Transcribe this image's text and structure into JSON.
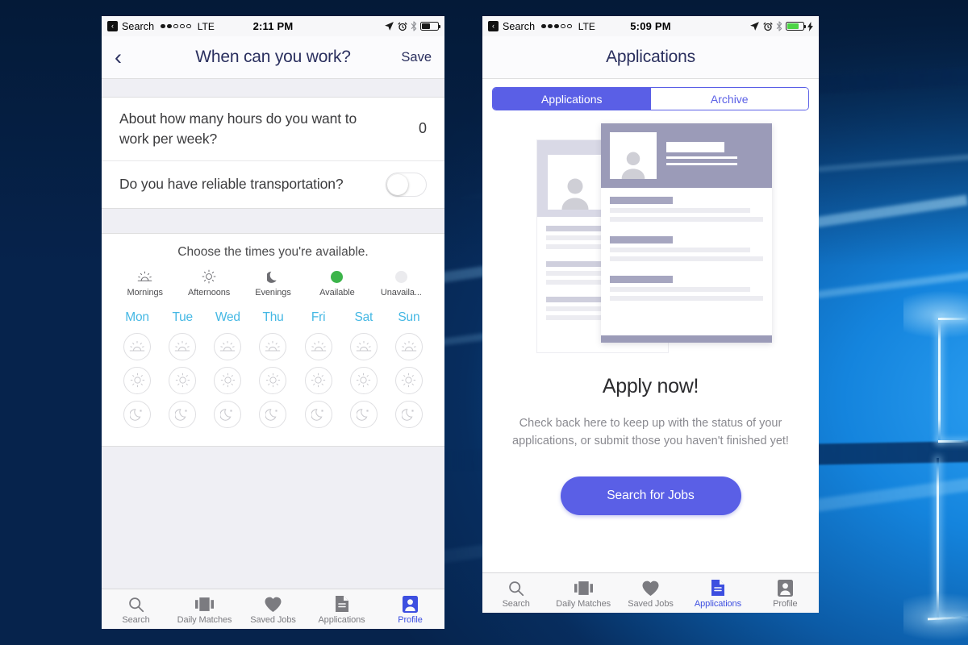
{
  "desktop": {
    "wallpaper_name": "windows-10-hero-wallpaper"
  },
  "left_phone": {
    "statusbar": {
      "back_badge": "‹",
      "carrier_label": "Search",
      "signal_dots_filled": 2,
      "signal_dots_total": 5,
      "network": "LTE",
      "time": "2:11 PM",
      "battery_level_pct": 55,
      "battery_charging": false
    },
    "navbar": {
      "back_icon": "‹",
      "title": "When can you work?",
      "action_label": "Save"
    },
    "form": {
      "hours_question": "About how many hours do you want to work per week?",
      "hours_value": "0",
      "transportation_question": "Do you have reliable transportation?",
      "transportation_on": false
    },
    "availability": {
      "title": "Choose the times you're available.",
      "legend": [
        {
          "label": "Mornings",
          "icon": "sunrise-icon"
        },
        {
          "label": "Afternoons",
          "icon": "sun-icon"
        },
        {
          "label": "Evenings",
          "icon": "moon-icon"
        },
        {
          "label": "Available",
          "icon": "green-dot-icon",
          "color": "#3cb44a"
        },
        {
          "label": "Unavaila...",
          "icon": "grey-dot-icon",
          "color": "#ebebee"
        }
      ],
      "days": [
        "Mon",
        "Tue",
        "Wed",
        "Thu",
        "Fri",
        "Sat",
        "Sun"
      ],
      "day_color": "#45b8e4",
      "rows": [
        {
          "period": "mornings",
          "icon": "sunrise-icon",
          "selected": [
            false,
            false,
            false,
            false,
            false,
            false,
            false
          ]
        },
        {
          "period": "afternoons",
          "icon": "sun-icon",
          "selected": [
            false,
            false,
            false,
            false,
            false,
            false,
            false
          ]
        },
        {
          "period": "evenings",
          "icon": "moon-icon",
          "selected": [
            false,
            false,
            false,
            false,
            false,
            false,
            false
          ]
        }
      ]
    },
    "tabbar": {
      "active_index": 4,
      "active_color": "#3d4fe0",
      "items": [
        {
          "label": "Search",
          "icon": "search-icon"
        },
        {
          "label": "Daily Matches",
          "icon": "cards-icon"
        },
        {
          "label": "Saved Jobs",
          "icon": "heart-icon"
        },
        {
          "label": "Applications",
          "icon": "document-icon"
        },
        {
          "label": "Profile",
          "icon": "person-icon"
        }
      ]
    }
  },
  "right_phone": {
    "statusbar": {
      "back_badge": "‹",
      "carrier_label": "Search",
      "signal_dots_filled": 3,
      "signal_dots_total": 5,
      "network": "LTE",
      "time": "5:09 PM",
      "battery_level_pct": 72,
      "battery_charging": true
    },
    "navbar": {
      "title": "Applications"
    },
    "segmented": {
      "active_index": 0,
      "accent_color": "#5a5fe6",
      "options": [
        "Applications",
        "Archive"
      ]
    },
    "empty_state": {
      "illustration": "resume-cards-illustration",
      "heading": "Apply now!",
      "description": "Check back here to keep up with the status of your applications, or submit those you haven't finished yet!",
      "cta_label": "Search for Jobs"
    },
    "tabbar": {
      "active_index": 3,
      "active_color": "#3d4fe0",
      "items": [
        {
          "label": "Search",
          "icon": "search-icon"
        },
        {
          "label": "Daily Matches",
          "icon": "cards-icon"
        },
        {
          "label": "Saved Jobs",
          "icon": "heart-icon"
        },
        {
          "label": "Applications",
          "icon": "document-icon"
        },
        {
          "label": "Profile",
          "icon": "person-icon"
        }
      ]
    }
  }
}
